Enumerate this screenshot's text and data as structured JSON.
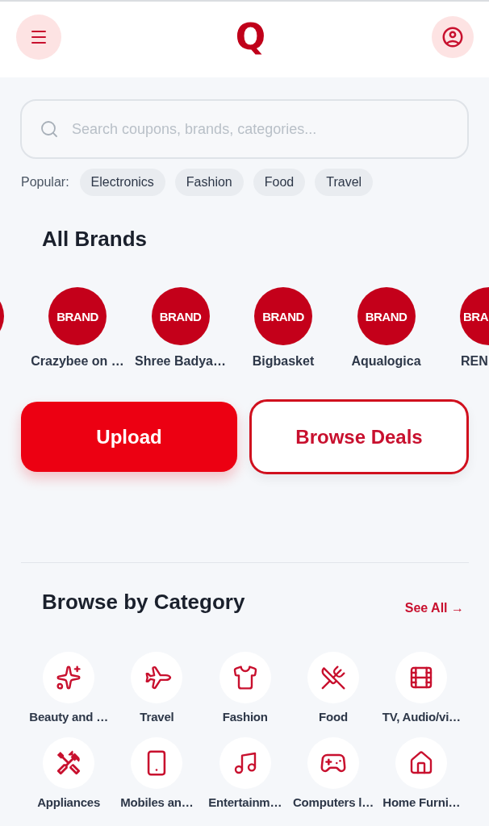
{
  "header": {
    "logo": "Q"
  },
  "search": {
    "placeholder": "Search coupons, brands, categories..."
  },
  "popular": {
    "label": "Popular:",
    "chips": [
      "Electronics",
      "Fashion",
      "Food",
      "Travel"
    ]
  },
  "brands_section": {
    "title": "All Brands",
    "brands": [
      {
        "kind": "cut_left"
      },
      {
        "kind": "full",
        "logo_text": "BRAND",
        "name": "Crazybee on …"
      },
      {
        "kind": "full",
        "logo_text": "BRAND",
        "name": "Shree Badya…"
      },
      {
        "kind": "full",
        "logo_text": "BRAND",
        "name": "Bigbasket"
      },
      {
        "kind": "full",
        "logo_text": "BRAND",
        "name": "Aqualogica"
      },
      {
        "kind": "cut_right",
        "logo_text": "BRA",
        "name": "REN"
      }
    ]
  },
  "actions": [
    {
      "kind": "primary",
      "label": "Upload"
    },
    {
      "kind": "outline",
      "label": "Browse Deals"
    }
  ],
  "category_section": {
    "title": "Browse by Category",
    "see_all": "See All →",
    "categories": [
      "Beauty and …",
      "Travel",
      "Fashion",
      "Food",
      "TV, Audio/vi…",
      "Appliances",
      "Mobiles an…",
      "Entertainm…",
      "Computers l…",
      "Home Furni…"
    ]
  }
}
